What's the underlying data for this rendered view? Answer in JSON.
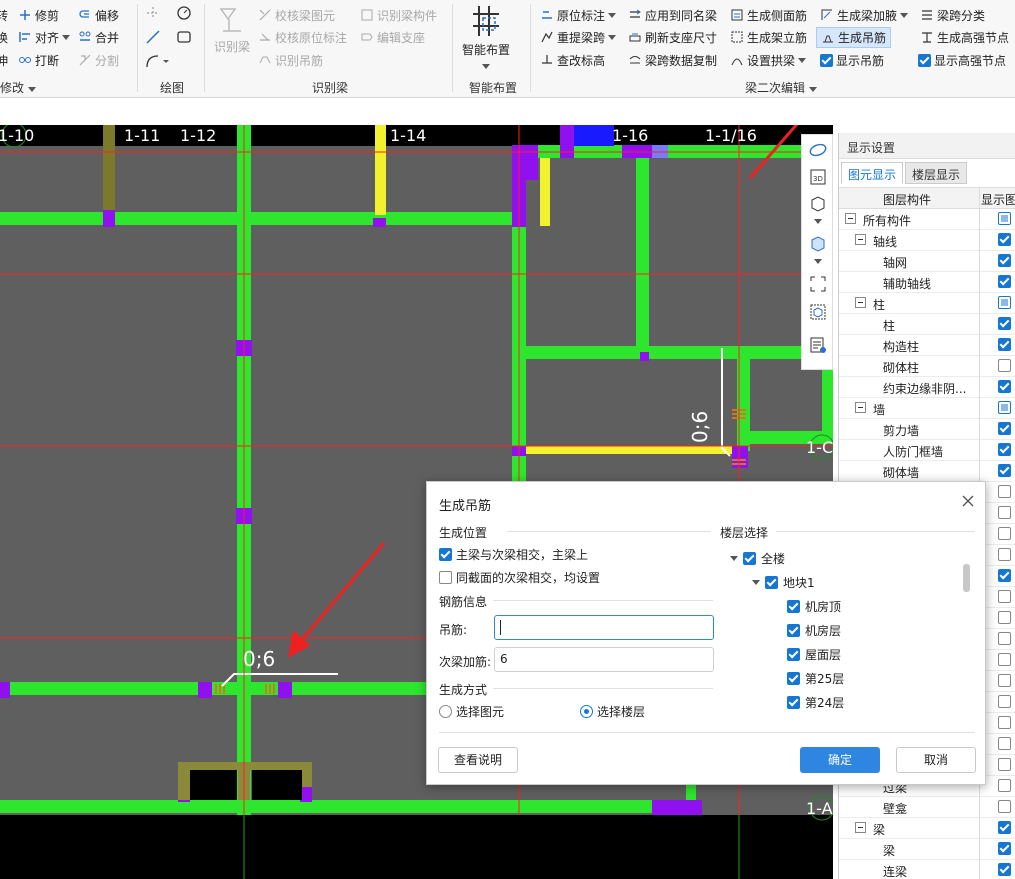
{
  "ribbon": {
    "modify": {
      "label": "修改",
      "items": [
        "转",
        "修剪",
        "偏移",
        "换",
        "对齐",
        "合并",
        "伸",
        "打断",
        "分割"
      ]
    },
    "draw": {
      "label": "绘图"
    },
    "identify": {
      "label": "识别梁",
      "big_button": "识别梁",
      "items": [
        "校核梁图元",
        "识别梁构件",
        "校核原位标注",
        "编辑支座",
        "识别吊筋"
      ]
    },
    "smart": {
      "label": "智能布置",
      "big_button": "智能布置"
    },
    "secondary": {
      "label": "梁二次编辑",
      "items": [
        "原位标注",
        "应用到同名梁",
        "生成侧面筋",
        "生成梁加腋",
        "梁跨分类",
        "重提梁跨",
        "刷新支座尺寸",
        "生成架立筋",
        "生成吊筋",
        "生成高强节点",
        "查改标高",
        "梁跨数据复制",
        "设置拱梁",
        "显示吊筋",
        "显示高强节点"
      ]
    }
  },
  "canvas": {
    "axes": [
      "1-10",
      "1-11",
      "1-12",
      "1-14",
      "1-16",
      "1-1/16",
      "1-C",
      "1-A"
    ],
    "annotations": [
      "0;6",
      "0;6"
    ]
  },
  "right_panel": {
    "title": "显示设置",
    "tabs": [
      "图元显示",
      "楼层显示"
    ],
    "columns": [
      "图层构件",
      "显示图"
    ],
    "rows": [
      {
        "label": "所有构件",
        "level": 0,
        "toggle": true,
        "state": "part"
      },
      {
        "label": "轴线",
        "level": 1,
        "toggle": true,
        "state": "on"
      },
      {
        "label": "轴网",
        "level": 2,
        "toggle": false,
        "state": "on"
      },
      {
        "label": "辅助轴线",
        "level": 2,
        "toggle": false,
        "state": "on"
      },
      {
        "label": "柱",
        "level": 1,
        "toggle": true,
        "state": "part"
      },
      {
        "label": "柱",
        "level": 2,
        "toggle": false,
        "state": "on"
      },
      {
        "label": "构造柱",
        "level": 2,
        "toggle": false,
        "state": "on"
      },
      {
        "label": "砌体柱",
        "level": 2,
        "toggle": false,
        "state": "off"
      },
      {
        "label": "约束边缘非阴...",
        "level": 2,
        "toggle": false,
        "state": "on"
      },
      {
        "label": "墙",
        "level": 1,
        "toggle": true,
        "state": "part"
      },
      {
        "label": "剪力墙",
        "level": 2,
        "toggle": false,
        "state": "on"
      },
      {
        "label": "人防门框墙",
        "level": 2,
        "toggle": false,
        "state": "on"
      },
      {
        "label": "砌体墙",
        "level": 2,
        "toggle": false,
        "state": "on"
      },
      {
        "label": "",
        "level": 2,
        "toggle": false,
        "state": "off"
      },
      {
        "label": "",
        "level": 2,
        "toggle": false,
        "state": "off"
      },
      {
        "label": "",
        "level": 2,
        "toggle": false,
        "state": "off"
      },
      {
        "label": "",
        "level": 2,
        "toggle": false,
        "state": "off"
      },
      {
        "label": "",
        "level": 2,
        "toggle": false,
        "state": "on"
      },
      {
        "label": "",
        "level": 2,
        "toggle": false,
        "state": "off"
      },
      {
        "label": "",
        "level": 2,
        "toggle": false,
        "state": "off"
      },
      {
        "label": "",
        "level": 2,
        "toggle": false,
        "state": "off"
      },
      {
        "label": "",
        "level": 2,
        "toggle": false,
        "state": "off"
      },
      {
        "label": "",
        "level": 2,
        "toggle": false,
        "state": "off"
      },
      {
        "label": "",
        "level": 2,
        "toggle": false,
        "state": "off"
      },
      {
        "label": "",
        "level": 2,
        "toggle": false,
        "state": "off"
      },
      {
        "label": "",
        "level": 2,
        "toggle": false,
        "state": "off"
      },
      {
        "label": "",
        "level": 2,
        "toggle": false,
        "state": "off"
      },
      {
        "label": "过梁",
        "level": 2,
        "toggle": false,
        "state": "off"
      },
      {
        "label": "壁龛",
        "level": 2,
        "toggle": false,
        "state": "off"
      },
      {
        "label": "梁",
        "level": 1,
        "toggle": true,
        "state": "on"
      },
      {
        "label": "梁",
        "level": 2,
        "toggle": false,
        "state": "on"
      },
      {
        "label": "连梁",
        "level": 2,
        "toggle": false,
        "state": "on"
      }
    ]
  },
  "dialog": {
    "title": "生成吊筋",
    "position_section": "生成位置",
    "opt_main": "主梁与次梁相交，主梁上",
    "opt_same": "同截面的次梁相交，均设置",
    "rebar_section": "钢筋信息",
    "hanger_label": "吊筋:",
    "hanger_value": "",
    "secondary_label": "次梁加筋:",
    "secondary_value": "6",
    "method_section": "生成方式",
    "radio_elements": "选择图元",
    "radio_floors": "选择楼层",
    "floor_section": "楼层选择",
    "floors": [
      {
        "label": "全楼",
        "level": 0,
        "expand": true
      },
      {
        "label": "地块1",
        "level": 1,
        "expand": true
      },
      {
        "label": "机房顶",
        "level": 2,
        "expand": false
      },
      {
        "label": "机房层",
        "level": 2,
        "expand": false
      },
      {
        "label": "屋面层",
        "level": 2,
        "expand": false
      },
      {
        "label": "第25层",
        "level": 2,
        "expand": false
      },
      {
        "label": "第24层",
        "level": 2,
        "expand": false
      }
    ],
    "help_button": "查看说明",
    "ok_button": "确定",
    "cancel_button": "取消"
  }
}
